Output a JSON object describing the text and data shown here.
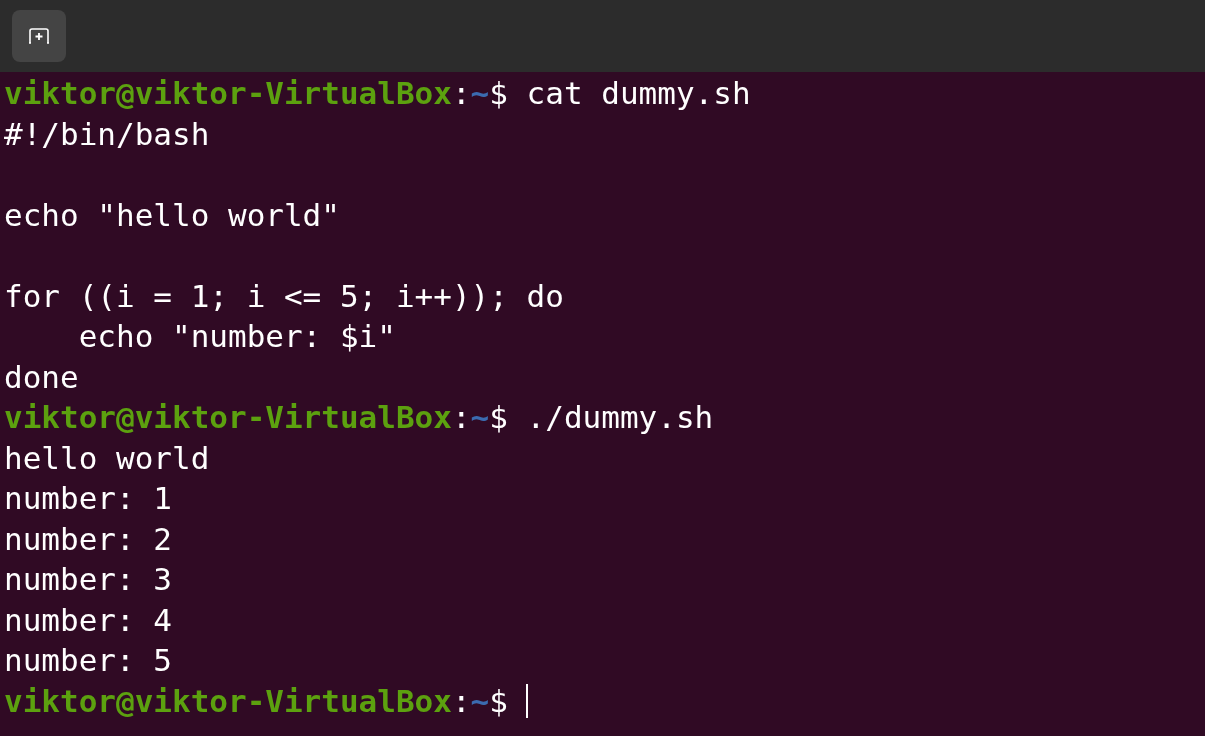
{
  "lines": [
    {
      "kind": "prompt",
      "user_host": "viktor@viktor-VirtualBox",
      "separator": ":",
      "path": "~",
      "symbol": "$",
      "command": "cat dummy.sh",
      "cursor": false
    },
    {
      "kind": "output",
      "text": "#!/bin/bash"
    },
    {
      "kind": "blank"
    },
    {
      "kind": "output",
      "text": "echo \"hello world\""
    },
    {
      "kind": "blank"
    },
    {
      "kind": "output",
      "text": "for ((i = 1; i <= 5; i++)); do"
    },
    {
      "kind": "output",
      "text": "    echo \"number: $i\""
    },
    {
      "kind": "output",
      "text": "done"
    },
    {
      "kind": "prompt",
      "user_host": "viktor@viktor-VirtualBox",
      "separator": ":",
      "path": "~",
      "symbol": "$",
      "command": "./dummy.sh",
      "cursor": false
    },
    {
      "kind": "output",
      "text": "hello world"
    },
    {
      "kind": "output",
      "text": "number: 1"
    },
    {
      "kind": "output",
      "text": "number: 2"
    },
    {
      "kind": "output",
      "text": "number: 3"
    },
    {
      "kind": "output",
      "text": "number: 4"
    },
    {
      "kind": "output",
      "text": "number: 5"
    },
    {
      "kind": "prompt",
      "user_host": "viktor@viktor-VirtualBox",
      "separator": ":",
      "path": "~",
      "symbol": "$",
      "cursor": true
    }
  ]
}
